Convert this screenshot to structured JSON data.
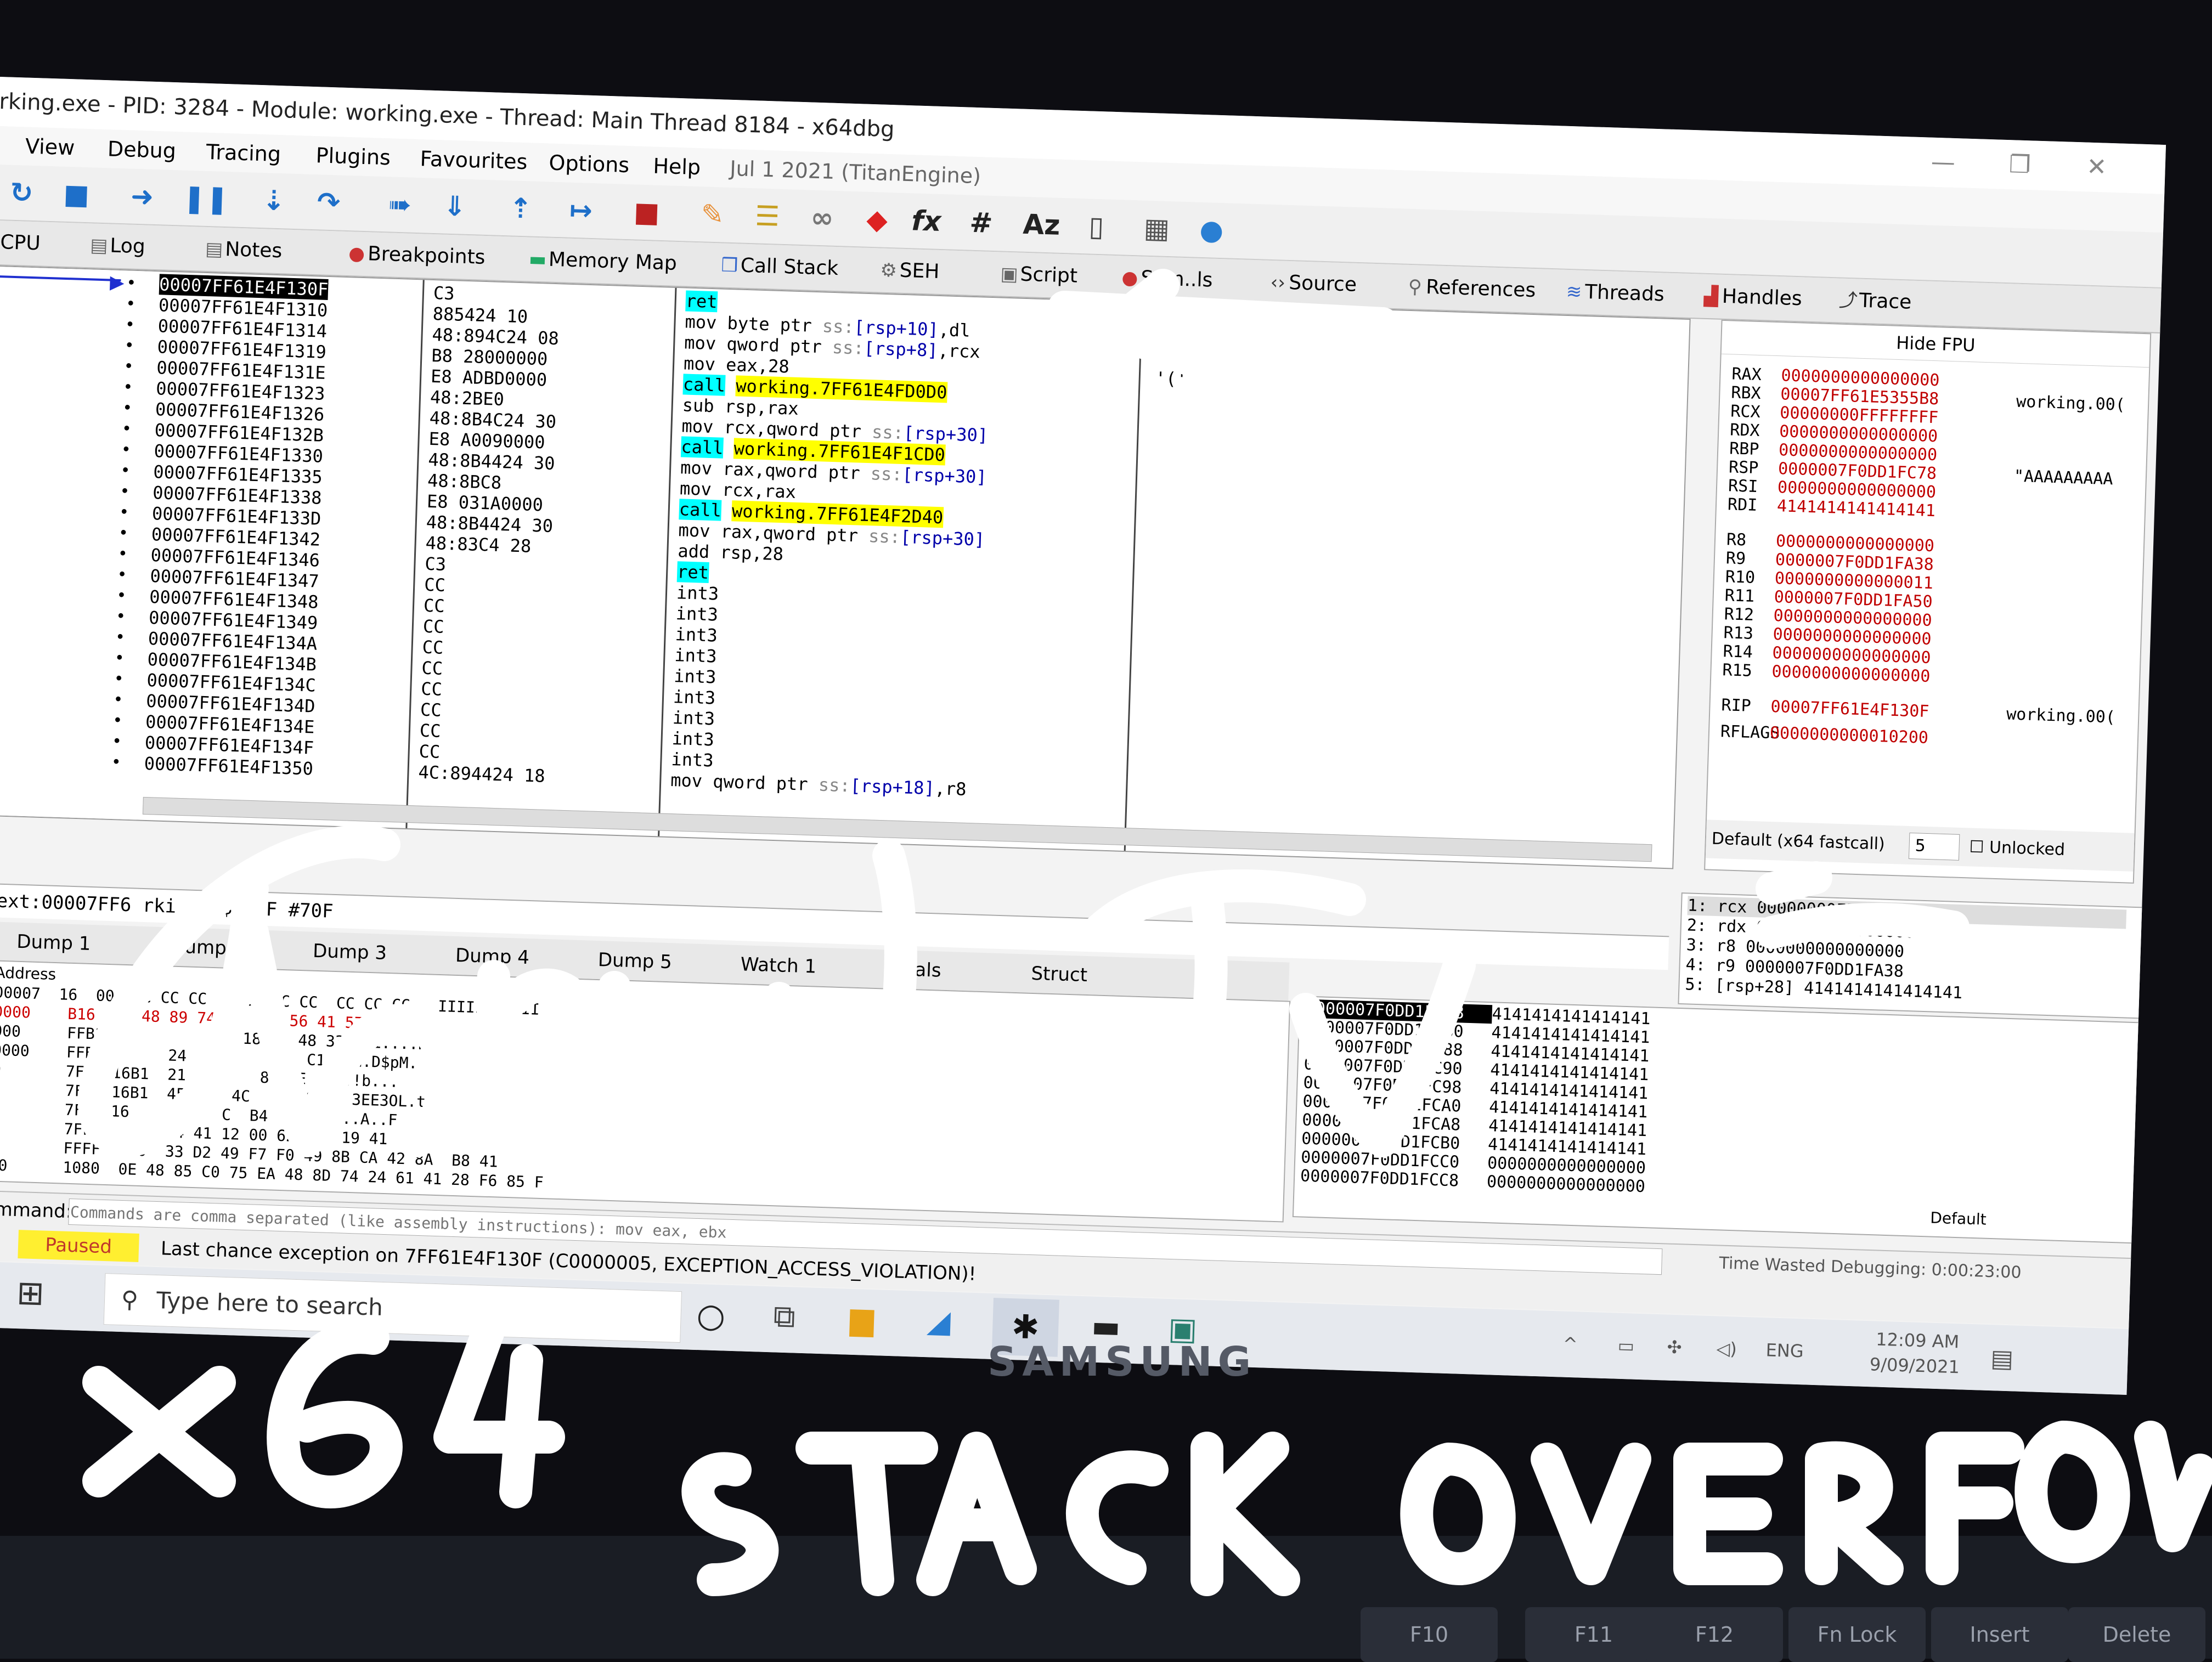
{
  "window": {
    "title": "rking.exe - PID: 3284 - Module: working.exe - Thread: Main Thread 8184 - x64dbg"
  },
  "menu": [
    "View",
    "Debug",
    "Tracing",
    "Plugins",
    "Favourites",
    "Options",
    "Help",
    "Jul 1 2021 (TitanEngine)"
  ],
  "tabs": [
    "CPU",
    "Log",
    "Notes",
    "Breakpoints",
    "Memory Map",
    "Call Stack",
    "SEH",
    "Script",
    "Sym..ls",
    "Source",
    "References",
    "Threads",
    "Handles",
    "Trace"
  ],
  "disassembly": [
    {
      "addr": "00007FF61E4F130F",
      "bytes": "C3",
      "ins": [
        {
          "t": "ret",
          "c": "ret"
        }
      ],
      "selected": true
    },
    {
      "addr": "00007FF61E4F1310",
      "bytes": "885424 10",
      "ins": [
        {
          "t": "mov byte ptr ",
          "c": ""
        },
        {
          "t": "ss:",
          "c": "seg"
        },
        {
          "t": "[rsp+10]",
          "c": "mem"
        },
        {
          "t": ",dl",
          "c": ""
        }
      ]
    },
    {
      "addr": "00007FF61E4F1314",
      "bytes": "48:894C24 08",
      "ins": [
        {
          "t": "mov qword ptr ",
          "c": ""
        },
        {
          "t": "ss:",
          "c": "seg"
        },
        {
          "t": "[rsp+8]",
          "c": "mem"
        },
        {
          "t": ",rcx",
          "c": ""
        }
      ]
    },
    {
      "addr": "00007FF61E4F1319",
      "bytes": "B8 28000000",
      "ins": [
        {
          "t": "mov eax,28",
          "c": ""
        }
      ],
      "cmt": "'('"
    },
    {
      "addr": "00007FF61E4F131E",
      "bytes": "E8 ADBD0000",
      "ins": [
        {
          "t": "call",
          "c": "call"
        },
        {
          "t": " ",
          "c": ""
        },
        {
          "t": "working.7FF61E4FD0D0",
          "c": "tgt"
        }
      ]
    },
    {
      "addr": "00007FF61E4F1323",
      "bytes": "48:2BE0",
      "ins": [
        {
          "t": "sub rsp,rax",
          "c": ""
        }
      ]
    },
    {
      "addr": "00007FF61E4F1326",
      "bytes": "48:8B4C24 30",
      "ins": [
        {
          "t": "mov rcx,qword ptr ",
          "c": ""
        },
        {
          "t": "ss:",
          "c": "seg"
        },
        {
          "t": "[rsp+30]",
          "c": "mem"
        }
      ]
    },
    {
      "addr": "00007FF61E4F132B",
      "bytes": "E8 A0090000",
      "ins": [
        {
          "t": "call",
          "c": "call"
        },
        {
          "t": " ",
          "c": ""
        },
        {
          "t": "working.7FF61E4F1CD0",
          "c": "tgt"
        }
      ]
    },
    {
      "addr": "00007FF61E4F1330",
      "bytes": "48:8B4424 30",
      "ins": [
        {
          "t": "mov rax,qword ptr ",
          "c": ""
        },
        {
          "t": "ss:",
          "c": "seg"
        },
        {
          "t": "[rsp+30]",
          "c": "mem"
        }
      ]
    },
    {
      "addr": "00007FF61E4F1335",
      "bytes": "48:8BC8",
      "ins": [
        {
          "t": "mov rcx,rax",
          "c": ""
        }
      ]
    },
    {
      "addr": "00007FF61E4F1338",
      "bytes": "E8 031A0000",
      "ins": [
        {
          "t": "call",
          "c": "call"
        },
        {
          "t": " ",
          "c": ""
        },
        {
          "t": "working.7FF61E4F2D40",
          "c": "tgt"
        }
      ]
    },
    {
      "addr": "00007FF61E4F133D",
      "bytes": "48:8B4424 30",
      "ins": [
        {
          "t": "mov rax,qword ptr ",
          "c": ""
        },
        {
          "t": "ss:",
          "c": "seg"
        },
        {
          "t": "[rsp+30]",
          "c": "mem"
        }
      ]
    },
    {
      "addr": "00007FF61E4F1342",
      "bytes": "48:83C4 28",
      "ins": [
        {
          "t": "add rsp,28",
          "c": ""
        }
      ]
    },
    {
      "addr": "00007FF61E4F1346",
      "bytes": "C3",
      "ins": [
        {
          "t": "ret",
          "c": "ret"
        }
      ]
    },
    {
      "addr": "00007FF61E4F1347",
      "bytes": "CC",
      "ins": [
        {
          "t": "int3",
          "c": ""
        }
      ]
    },
    {
      "addr": "00007FF61E4F1348",
      "bytes": "CC",
      "ins": [
        {
          "t": "int3",
          "c": ""
        }
      ]
    },
    {
      "addr": "00007FF61E4F1349",
      "bytes": "CC",
      "ins": [
        {
          "t": "int3",
          "c": ""
        }
      ]
    },
    {
      "addr": "00007FF61E4F134A",
      "bytes": "CC",
      "ins": [
        {
          "t": "int3",
          "c": ""
        }
      ]
    },
    {
      "addr": "00007FF61E4F134B",
      "bytes": "CC",
      "ins": [
        {
          "t": "int3",
          "c": ""
        }
      ]
    },
    {
      "addr": "00007FF61E4F134C",
      "bytes": "CC",
      "ins": [
        {
          "t": "int3",
          "c": ""
        }
      ]
    },
    {
      "addr": "00007FF61E4F134D",
      "bytes": "CC",
      "ins": [
        {
          "t": "int3",
          "c": ""
        }
      ]
    },
    {
      "addr": "00007FF61E4F134E",
      "bytes": "CC",
      "ins": [
        {
          "t": "int3",
          "c": ""
        }
      ]
    },
    {
      "addr": "00007FF61E4F134F",
      "bytes": "CC",
      "ins": [
        {
          "t": "int3",
          "c": ""
        }
      ]
    },
    {
      "addr": "00007FF61E4F1350",
      "bytes": "4C:894424 18",
      "ins": [
        {
          "t": "mov qword ptr ",
          "c": ""
        },
        {
          "t": "ss:",
          "c": "seg"
        },
        {
          "t": "[rsp+18]",
          "c": "mem"
        },
        {
          "t": ",r8",
          "c": ""
        }
      ]
    }
  ],
  "registers": {
    "header": "Hide FPU",
    "general": [
      {
        "n": "RAX",
        "v": "0000000000000000"
      },
      {
        "n": "RBX",
        "v": "00007FF61E5355B8",
        "c": "working.00("
      },
      {
        "n": "RCX",
        "v": "00000000FFFFFFFF"
      },
      {
        "n": "RDX",
        "v": "0000000000000000"
      },
      {
        "n": "RBP",
        "v": "0000000000000000"
      },
      {
        "n": "RSP",
        "v": "0000007F0DD1FC78",
        "c": "\"AAAAAAAAA"
      },
      {
        "n": "RSI",
        "v": "0000000000000000"
      },
      {
        "n": "RDI",
        "v": "4141414141414141"
      }
    ],
    "extended": [
      {
        "n": "R8",
        "v": "0000000000000000"
      },
      {
        "n": "R9",
        "v": "0000007F0DD1FA38"
      },
      {
        "n": "R10",
        "v": "0000000000000011"
      },
      {
        "n": "R11",
        "v": "0000007F0DD1FA50"
      },
      {
        "n": "R12",
        "v": "0000000000000000"
      },
      {
        "n": "R13",
        "v": "0000000000000000"
      },
      {
        "n": "R14",
        "v": "0000000000000000"
      },
      {
        "n": "R15",
        "v": "0000000000000000"
      }
    ],
    "rip": {
      "n": "RIP",
      "v": "00007FF61E4F130F",
      "c": "working.00("
    },
    "rflags": {
      "n": "RFLAGS",
      "v": "0000000000010200"
    },
    "callconv": "Default (x64 fastcall)",
    "argcount": "5",
    "unlocked_label": "Unlocked"
  },
  "args": [
    "1: rcx 00000000FFFFFFFF",
    "2: rdx 0000000000000000",
    "3: r8 0000000000000000",
    "4: r9 0000007F0DD1FA38",
    "5: [rsp+28] 4141414141414141"
  ],
  "info_line": ".text:00007FF6   rki   xe:$130F #70F",
  "dump_tabs": [
    "Dump 1",
    "Dump 2",
    "Dump 3",
    "Dump 4",
    "Dump 5",
    "Watch 1",
    "Locals",
    "Struct"
  ],
  "dump": {
    "header": "Address",
    "rows": [
      "00007  16  00  CC CC CC CC CC CC CC  CC CC CC   IIIIIIIIIII",
      "0000    B16     48 89 74     41 56 41 57  WH",
      "000     FFB16              18 00 48 33   1....H.",
      "0000    FFB16B     24          33 C1   H.D$pM.",
      "0       7FFFB16B1  21 6      8D 8E   ..!b...",
      "0       7FFFB16B1  45 3   4C   14 8B   3EE3OL.t",
      "0       7FFFB16    85    C  B4   8D   ..A..F",
      "0       7FFFB16    B4 41 12 00 62 8A  19 41",
      "0       FFFF  070  33 D2 49 F7 F0 49 8B CA 42 8A  B8 41",
      "00      1080  0E 48 85 C0 75 EA 48 8D 74 24 61 41 28 F6 85 F"
    ]
  },
  "stack": [
    {
      "a": "0000007F0DD1FC78",
      "v": "4141414141414141",
      "hl": true
    },
    {
      "a": "0000007F0DD1FC80",
      "v": "4141414141414141"
    },
    {
      "a": "0000007F0DD1FC88",
      "v": "4141414141414141"
    },
    {
      "a": "0000007F0DD1FC90",
      "v": "4141414141414141"
    },
    {
      "a": "0000007F0DD1FC98",
      "v": "4141414141414141"
    },
    {
      "a": "0000007F0DD1FCA0",
      "v": "4141414141414141"
    },
    {
      "a": "0000007F0DD1FCA8",
      "v": "4141414141414141"
    },
    {
      "a": "0000007F0DD1FCB0",
      "v": "4141414141414141"
    },
    {
      "a": "0000007F0DD1FCC0",
      "v": "0000000000000000"
    },
    {
      "a": "0000007F0DD1FCC8",
      "v": "0000000000000000"
    }
  ],
  "stack_default": "Default",
  "command": {
    "label": "Command:",
    "placeholder": "Commands are comma separated (like assembly instructions): mov eax, ebx",
    "wasted": "Time Wasted Debugging: 0:00:23:00"
  },
  "status": {
    "state": "Paused",
    "message": "Last chance exception on 7FF61E4F130F (C0000005, EXCEPTION_ACCESS_VIOLATION)!"
  },
  "taskbar": {
    "search_placeholder": "Type here to search",
    "time": "12:09 AM",
    "date": "9/09/2021",
    "lang": "ENG"
  },
  "bezel": "SAMSUNG",
  "keys": [
    "F10",
    "F11",
    "F12",
    "Fn Lock",
    "Insert",
    "Delete"
  ],
  "colors": {
    "accent": "#1e6fc9",
    "call_bg": "#00ffff",
    "target_bg": "#ffff00",
    "reg_value": "#c00000",
    "paused_bg": "#ffef30"
  }
}
